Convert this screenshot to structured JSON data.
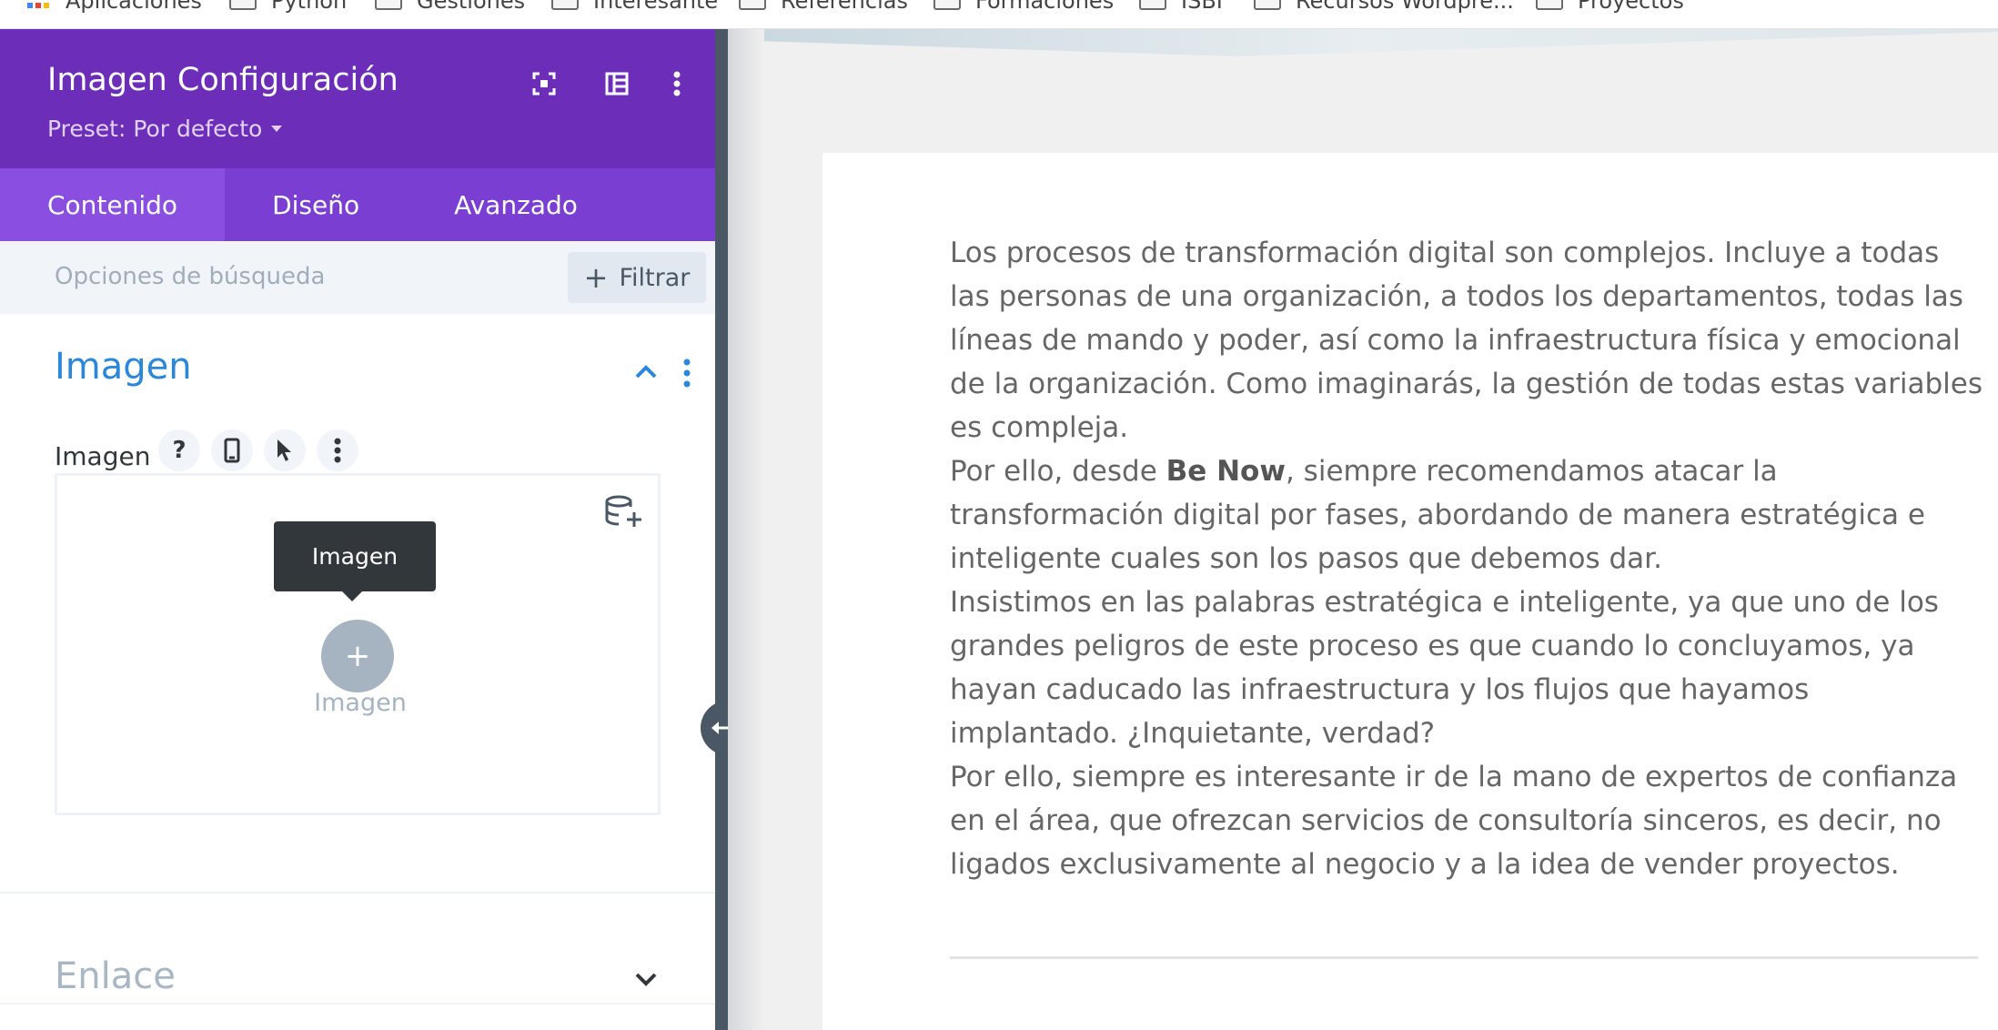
{
  "bookmarks": [
    {
      "label": "Aplicaciones",
      "type": "apps"
    },
    {
      "label": "Python",
      "type": "folder"
    },
    {
      "label": "Gestiones",
      "type": "folder"
    },
    {
      "label": "Interesante",
      "type": "folder"
    },
    {
      "label": "Referencias",
      "type": "folder"
    },
    {
      "label": "Formaciones",
      "type": "folder"
    },
    {
      "label": "ISBI",
      "type": "folder"
    },
    {
      "label": "Recursos Wordpre...",
      "type": "folder"
    },
    {
      "label": "Proyectos",
      "type": "folder"
    }
  ],
  "panel": {
    "title": "Imagen Configuración",
    "preset": "Preset: Por defecto",
    "header_icons": [
      "fullscreen-icon",
      "columns-icon",
      "more-vertical-icon"
    ],
    "tabs": [
      {
        "label": "Contenido",
        "active": true
      },
      {
        "label": "Diseño",
        "active": false
      },
      {
        "label": "Avanzado",
        "active": false
      }
    ],
    "search_placeholder": "Opciones de búsqueda",
    "filter_label": "Filtrar",
    "section_title": "Imagen",
    "field_label": "Imagen",
    "field_buttons": [
      "help-icon",
      "mobile-icon",
      "cursor-icon",
      "more-vertical-icon"
    ],
    "tooltip": "Imagen",
    "upload_label": "Imagen",
    "collapsed_section": "Enlace"
  },
  "colors": {
    "header_purple": "#6c2eb9",
    "tab_purple": "#7b3ed3",
    "accent_blue": "#2b87da"
  },
  "article": {
    "p1": "Los procesos de transformación digital son complejos. Incluye a todas las personas de una organización, a todos los departamentos, todas las líneas de mando y poder, así como la infraestructura física y emocional de la organización. Como imaginarás, la gestión de todas estas variables es compleja.",
    "p2_pre": "Por ello, desde ",
    "p2_bold": "Be Now",
    "p2_post": ", siempre recomendamos atacar la transformación digital por fases, abordando de manera estratégica e inteligente cuales son los pasos que debemos dar.",
    "p3": "Insistimos en las palabras estratégica e inteligente, ya que uno de los grandes peligros de este proceso es que cuando lo concluyamos, ya hayan caducado las infraestructura y los flujos que hayamos implantado. ¿Inquietante, verdad?",
    "p4": "Por ello, siempre es interesante ir de la mano de expertos de confianza en el área, que ofrezcan servicios de consultoría sinceros, es decir, no ligados exclusivamente al negocio y a la idea de vender proyectos."
  }
}
